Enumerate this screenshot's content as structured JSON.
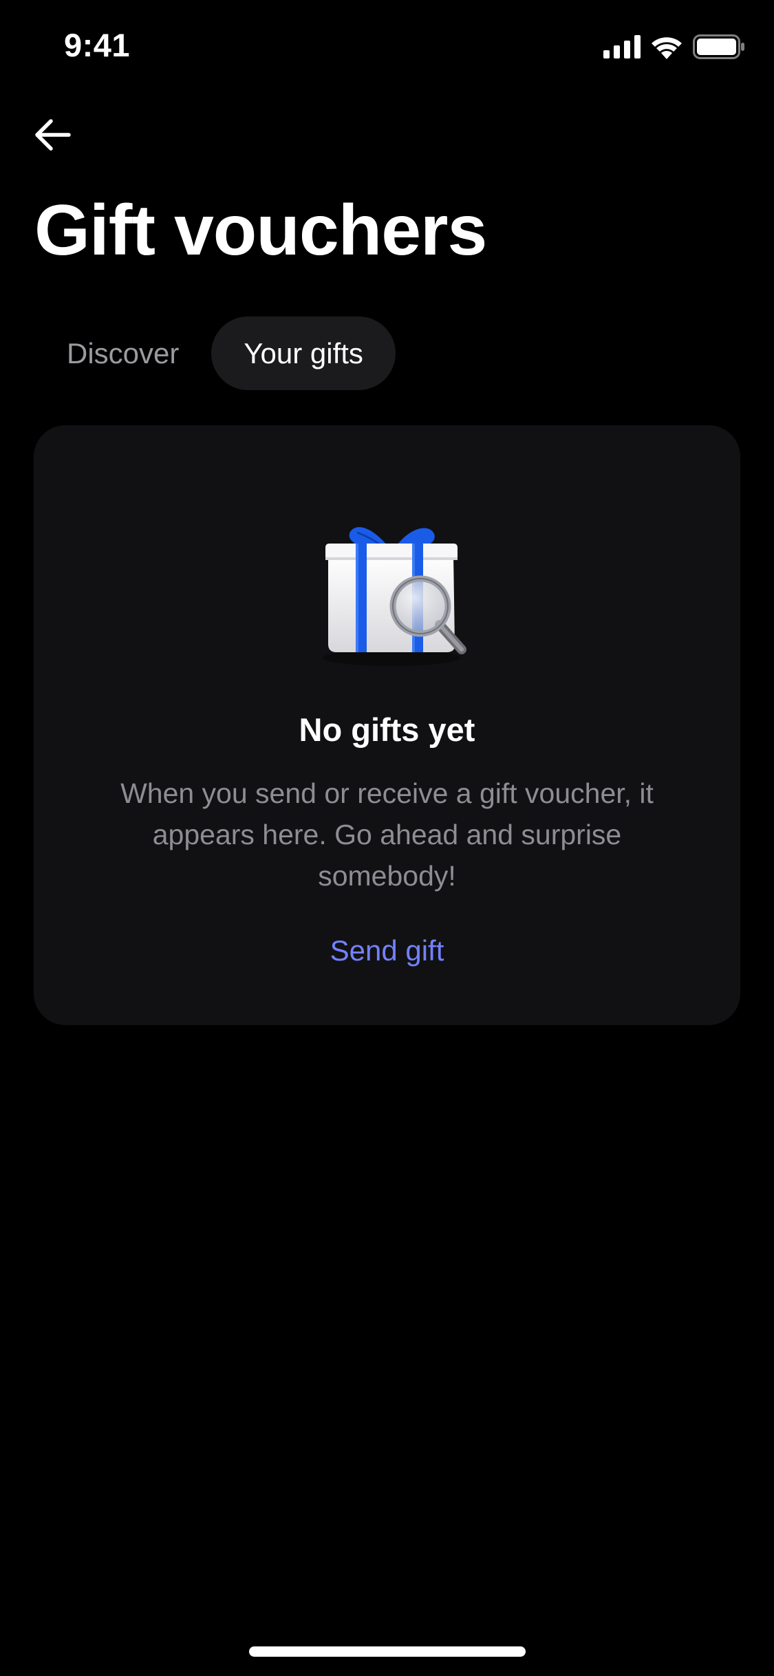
{
  "status_bar": {
    "time": "9:41",
    "icons": [
      "cellular-signal-icon",
      "wifi-icon",
      "battery-icon"
    ]
  },
  "header": {
    "back_icon": "arrow-left-icon",
    "title": "Gift vouchers"
  },
  "tabs": [
    {
      "label": "Discover",
      "active": false
    },
    {
      "label": "Your gifts",
      "active": true
    }
  ],
  "empty_state": {
    "illustration": "gift-box-with-magnifier-icon",
    "title": "No gifts yet",
    "description": "When you send or receive a gift voucher, it appears here. Go ahead and surprise somebody!",
    "action_label": "Send gift"
  },
  "colors": {
    "background": "#000000",
    "card": "#111113",
    "active_tab": "#1b1b1d",
    "accent": "#7381ff",
    "ribbon": "#1a5ce8",
    "muted_text": "#8d8d93"
  }
}
